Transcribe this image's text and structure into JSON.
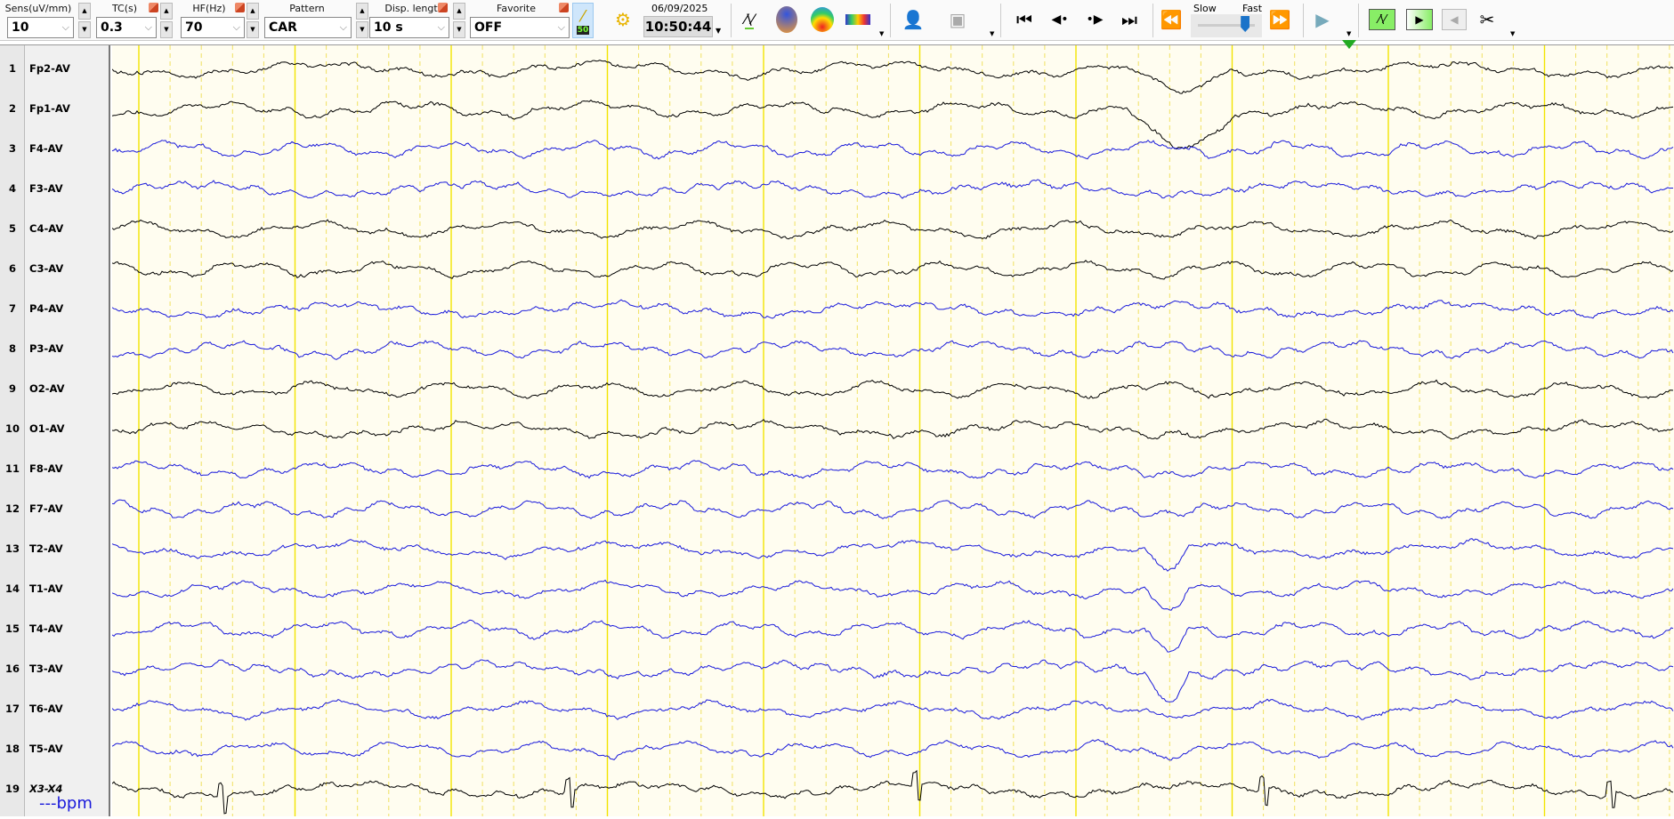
{
  "toolbar": {
    "sens": {
      "label": "Sens(uV/mm)",
      "value": "10"
    },
    "tc": {
      "label": "TC(s)",
      "value": "0.3"
    },
    "hf": {
      "label": "HF(Hz)",
      "value": "70"
    },
    "pattern": {
      "label": "Pattern",
      "value": "CAR"
    },
    "disp_length": {
      "label": "Disp. length",
      "value": "10 s"
    },
    "favorite": {
      "label": "Favorite",
      "value": "OFF"
    },
    "filter_badge": "50",
    "date": "06/09/2025",
    "time": "10:50:44",
    "speed_slow": "Slow",
    "speed_fast": "Fast",
    "speed_level": 0.9
  },
  "channels": [
    {
      "num": "1",
      "name": "Fp2-AV",
      "color": "#000000"
    },
    {
      "num": "2",
      "name": "Fp1-AV",
      "color": "#000000"
    },
    {
      "num": "3",
      "name": "F4-AV",
      "color": "#1a1adb"
    },
    {
      "num": "4",
      "name": "F3-AV",
      "color": "#1a1adb"
    },
    {
      "num": "5",
      "name": "C4-AV",
      "color": "#000000"
    },
    {
      "num": "6",
      "name": "C3-AV",
      "color": "#000000"
    },
    {
      "num": "7",
      "name": "P4-AV",
      "color": "#1a1adb"
    },
    {
      "num": "8",
      "name": "P3-AV",
      "color": "#1a1adb"
    },
    {
      "num": "9",
      "name": "O2-AV",
      "color": "#000000"
    },
    {
      "num": "10",
      "name": "O1-AV",
      "color": "#000000"
    },
    {
      "num": "11",
      "name": "F8-AV",
      "color": "#1a1adb"
    },
    {
      "num": "12",
      "name": "F7-AV",
      "color": "#1a1adb"
    },
    {
      "num": "13",
      "name": "T2-AV",
      "color": "#1a1adb"
    },
    {
      "num": "14",
      "name": "T1-AV",
      "color": "#1a1adb"
    },
    {
      "num": "15",
      "name": "T4-AV",
      "color": "#1a1adb"
    },
    {
      "num": "16",
      "name": "T3-AV",
      "color": "#1a1adb"
    },
    {
      "num": "17",
      "name": "T6-AV",
      "color": "#1a1adb"
    },
    {
      "num": "18",
      "name": "T5-AV",
      "color": "#1a1adb"
    },
    {
      "num": "19",
      "name": "X3-X4",
      "color": "#000000"
    }
  ],
  "heart_rate": "---bpm"
}
